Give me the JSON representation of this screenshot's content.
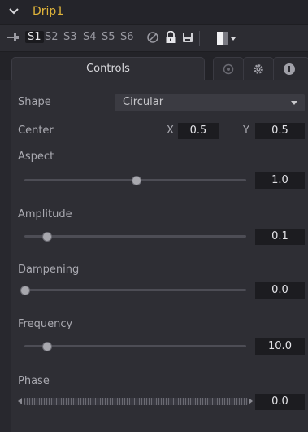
{
  "header": {
    "title": "Drip1"
  },
  "toolbar": {
    "slots": [
      "S1",
      "S2",
      "S3",
      "S4",
      "S5",
      "S6"
    ],
    "active_slot": "S1"
  },
  "tabs": {
    "controls_label": "Controls"
  },
  "shape": {
    "label": "Shape",
    "value": "Circular"
  },
  "center": {
    "label": "Center",
    "x_label": "X",
    "x_value": "0.5",
    "y_label": "Y",
    "y_value": "0.5"
  },
  "aspect": {
    "label": "Aspect",
    "value": "1.0",
    "level": 0.5
  },
  "amplitude": {
    "label": "Amplitude",
    "value": "0.1",
    "level": 0.1
  },
  "dampening": {
    "label": "Dampening",
    "value": "0.0",
    "level": 0.0
  },
  "frequency": {
    "label": "Frequency",
    "value": "10.0",
    "level": 0.1
  },
  "phase": {
    "label": "Phase",
    "value": "0.0"
  },
  "colors": {
    "accent": "#e0b43a",
    "panel": "#2e2e34",
    "value_box": "#1c1c20"
  }
}
